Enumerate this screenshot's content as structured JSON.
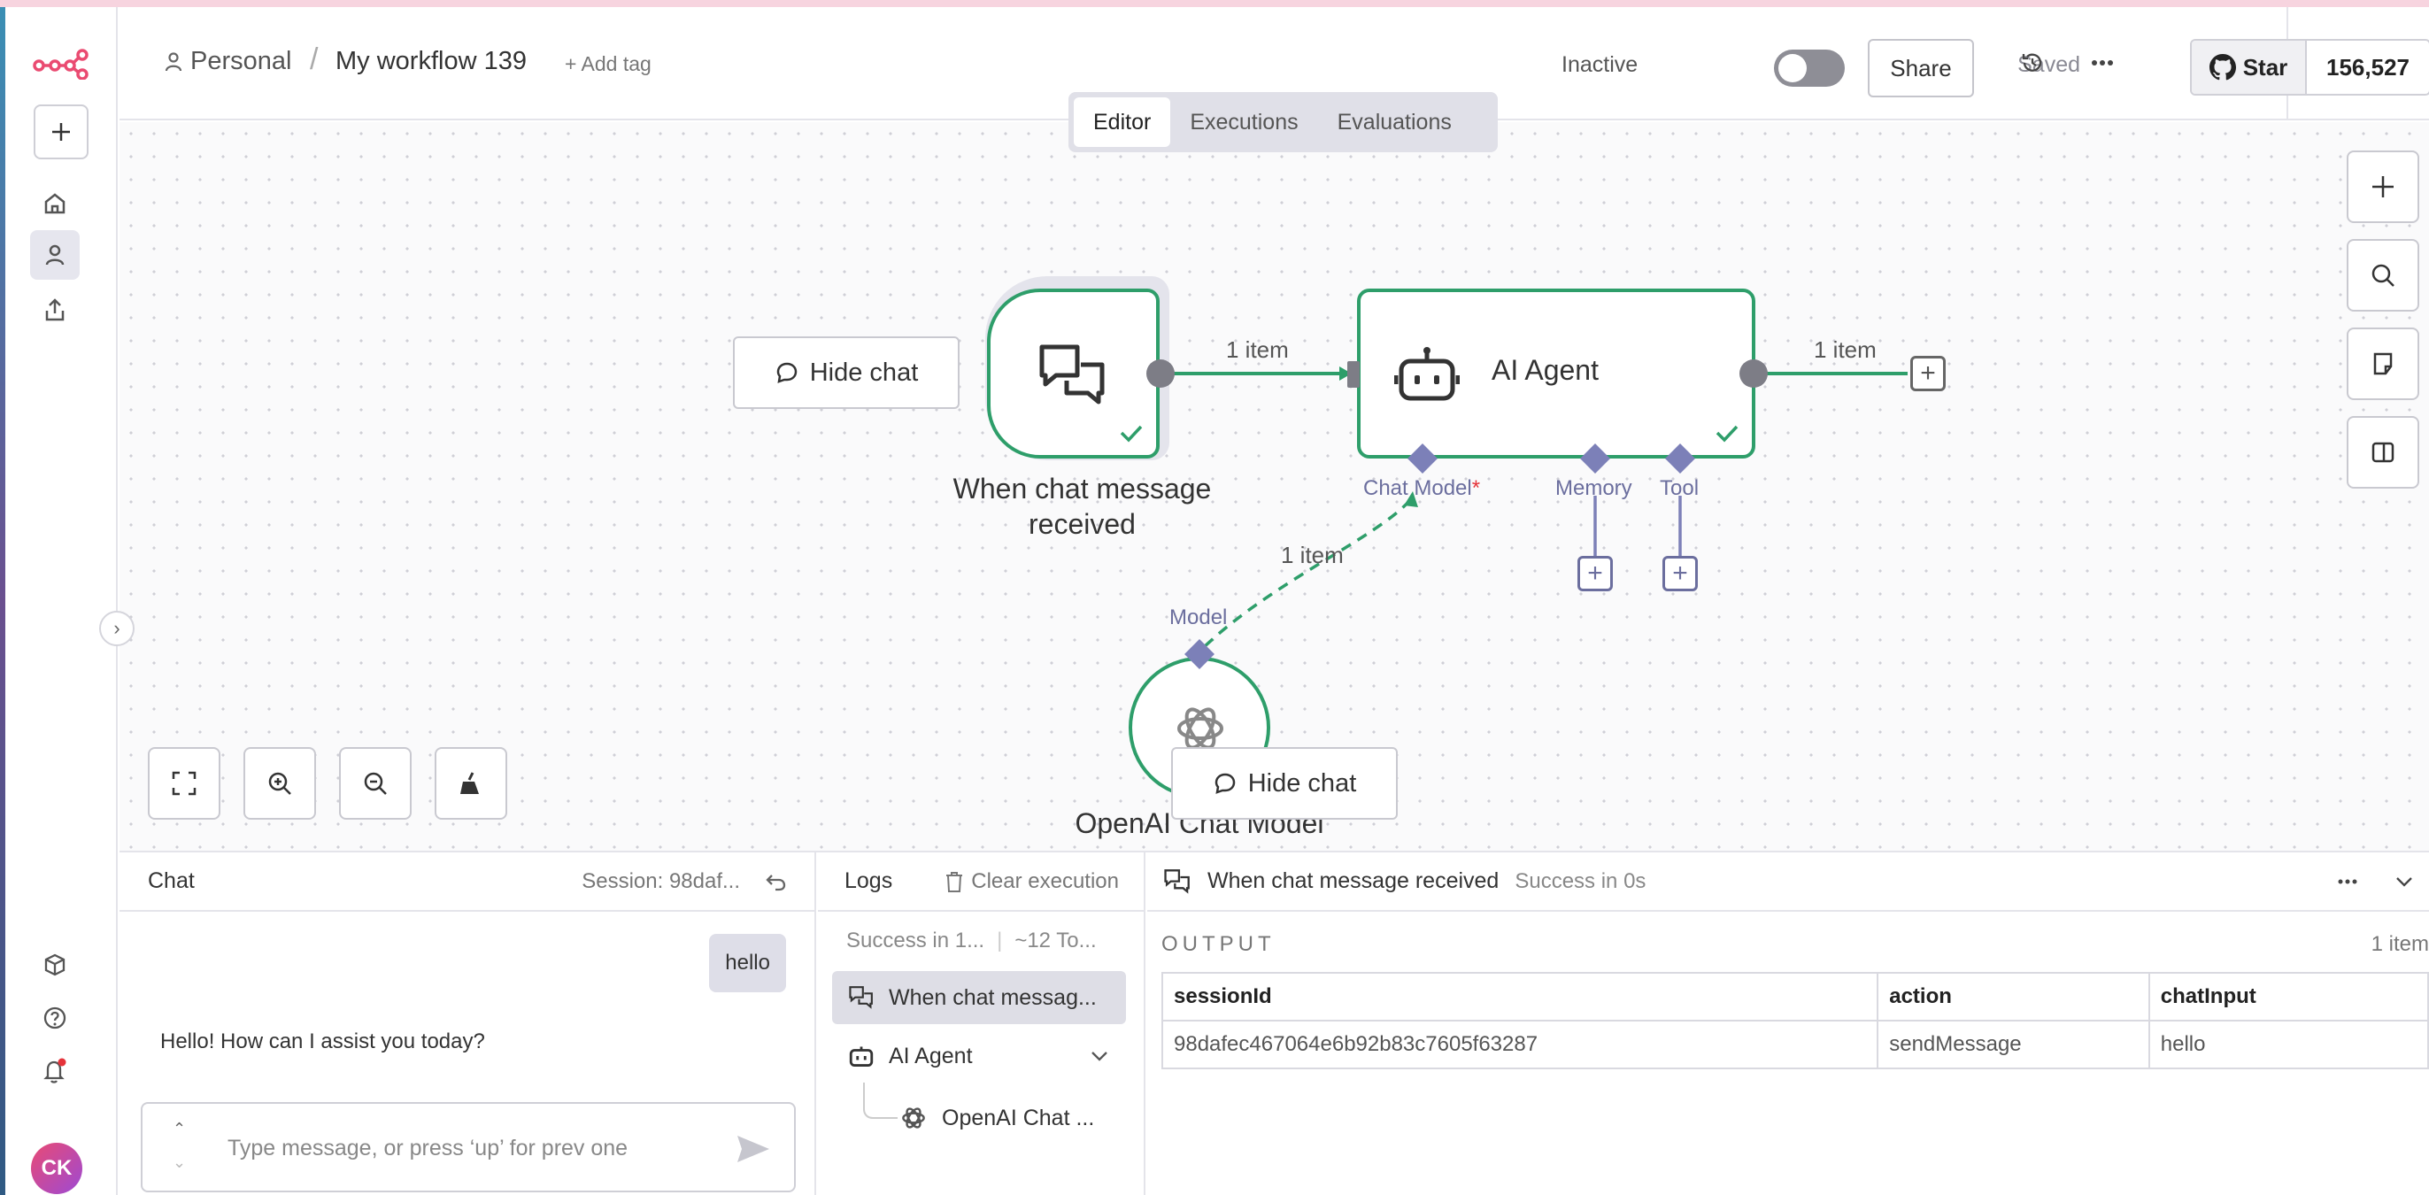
{
  "header": {
    "project": "Personal",
    "separator": "/",
    "workflow_name": "My workflow 139",
    "add_tag": "+ Add tag",
    "active_label": "Inactive",
    "share": "Share",
    "saved": "Saved",
    "github_star": "Star",
    "github_count": "156,527"
  },
  "tabs": [
    "Editor",
    "Executions",
    "Evaluations"
  ],
  "canvas": {
    "trigger_node": "When chat message received",
    "agent_node": "AI Agent",
    "model_node": "OpenAI Chat Model",
    "edge_label_1": "1 item",
    "edge_label_2": "1 item",
    "edge_label_3": "1 item",
    "port_chat_model": "Chat Model",
    "port_required": "*",
    "port_memory": "Memory",
    "port_tool": "Tool",
    "port_model": "Model",
    "hide_chat_1": "Hide chat",
    "hide_chat_2": "Hide chat"
  },
  "chat": {
    "title": "Chat",
    "session": "Session: 98daf...",
    "user_message": "hello",
    "bot_message": "Hello! How can I assist you today?",
    "input_placeholder": "Type message, or press ‘up’ for prev one"
  },
  "logs": {
    "title": "Logs",
    "clear": "Clear execution",
    "summary_status": "Success in 1...",
    "summary_tokens": "~12 To...",
    "items": [
      {
        "label": "When chat messag..."
      },
      {
        "label": "AI Agent"
      },
      {
        "label": "OpenAI Chat ..."
      }
    ]
  },
  "output": {
    "node": "When chat message received",
    "status": "Success in 0s",
    "heading": "OUTPUT",
    "count": "1 item",
    "columns": [
      "sessionId",
      "action",
      "chatInput"
    ],
    "row": [
      "98dafec467064e6b92b83c7605f63287",
      "sendMessage",
      "hello"
    ]
  },
  "colors": {
    "success_green": "#2e9e6a",
    "port_purple": "#7c80b8",
    "brand_pink": "#ea4b71"
  }
}
